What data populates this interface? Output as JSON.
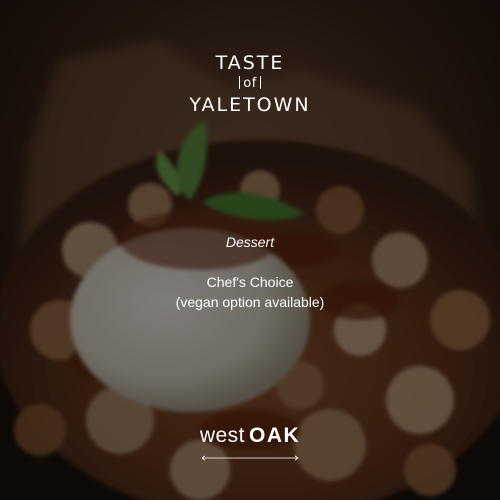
{
  "event_logo": {
    "line1": "TASTE",
    "line2": "of",
    "line3": "YALETOWN"
  },
  "menu": {
    "course": "Dessert",
    "dish_name": "Chef's Choice",
    "dish_note": "(vegan option available)"
  },
  "restaurant_logo": {
    "word1": "west",
    "word2": "OAK"
  },
  "colors": {
    "text": "#ffffff",
    "overlay": "#000000",
    "caramel": "#7a3a1c",
    "cream": "#e8e0d4"
  },
  "icons": {
    "fork": "fork-icon",
    "knife": "knife-icon",
    "arrow_rule": "double-arrow-rule"
  }
}
